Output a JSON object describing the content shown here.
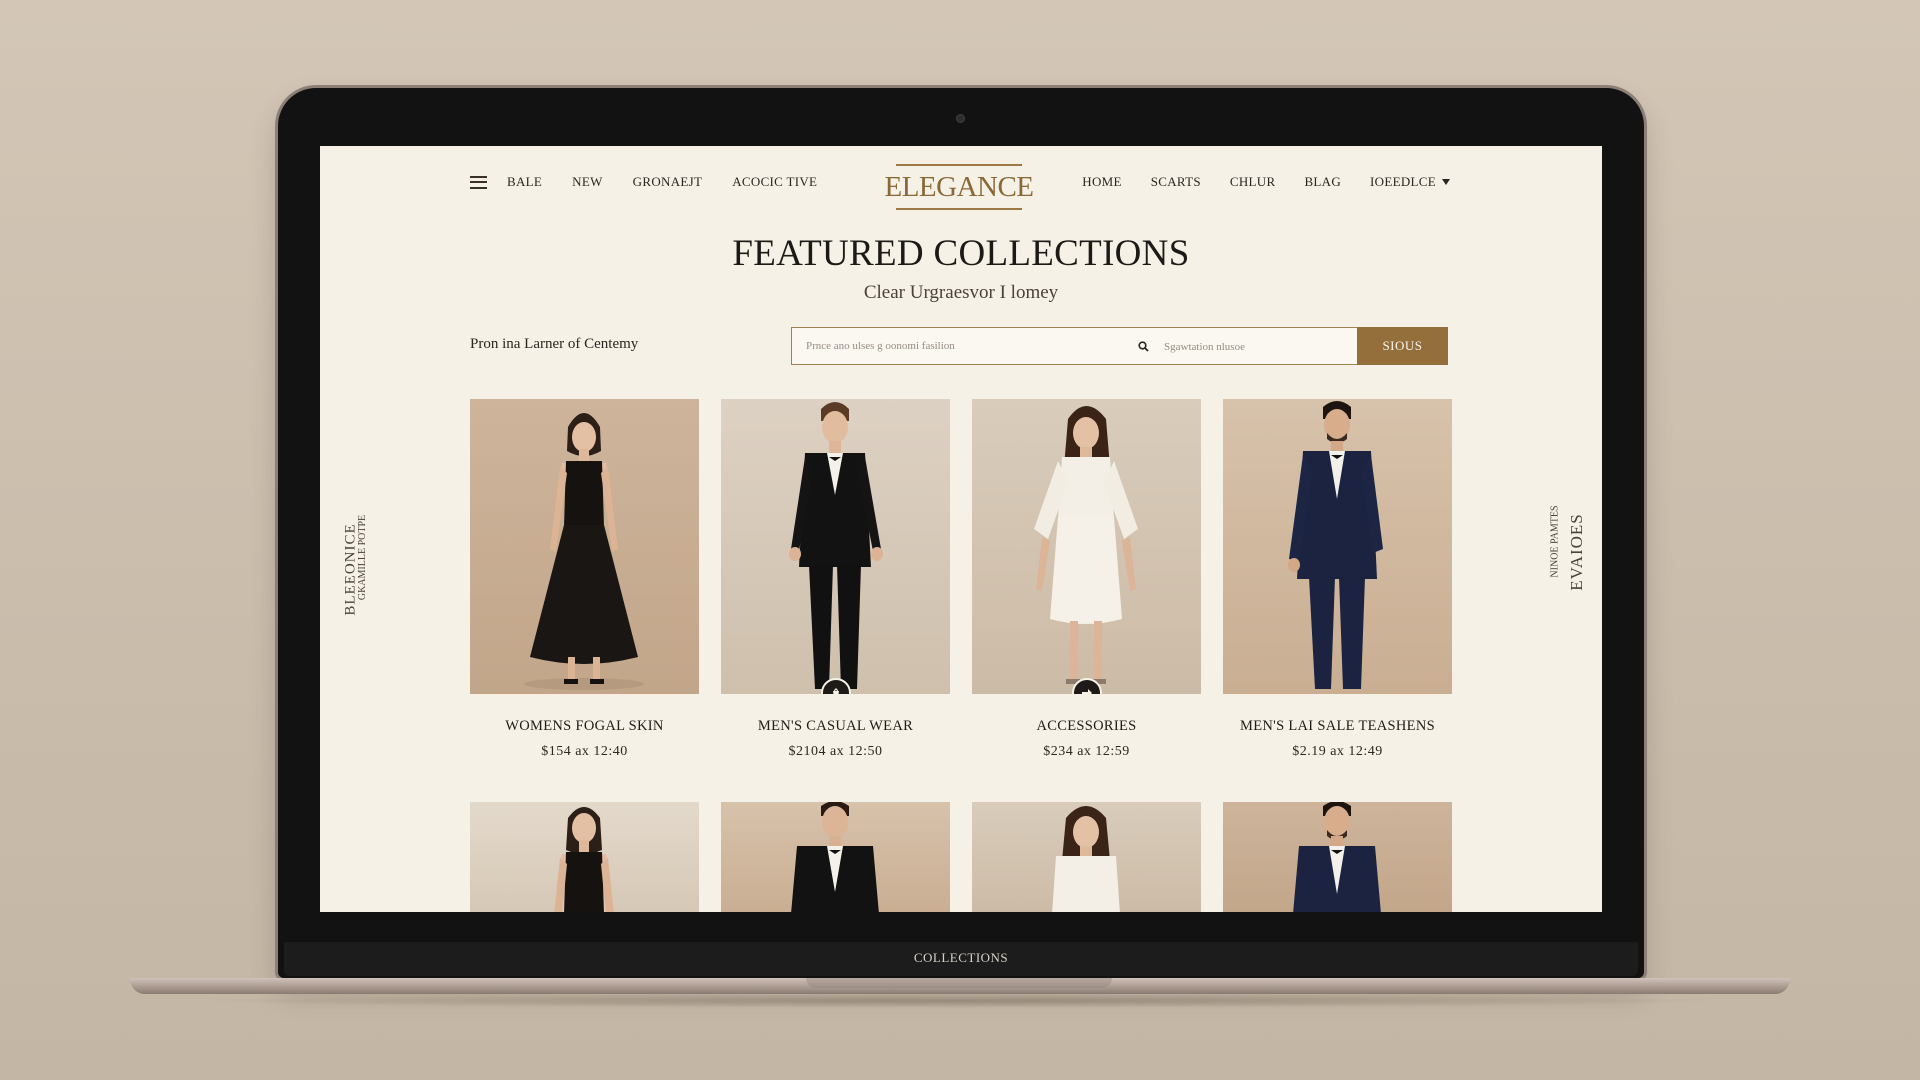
{
  "nav": {
    "left": [
      "BALE",
      "NEW",
      "GRONAEJT",
      "ACOCIC TIVE"
    ],
    "logo": "ELEGANCE",
    "right": [
      "HOME",
      "SCARTS",
      "CHLUR",
      "BLAG",
      "IOEEDLCE"
    ]
  },
  "page": {
    "title": "FEATURED COLLECTIONS",
    "subtitle": "Clear Urgraesvor I lomey",
    "promo": "Pron ina Larner of Centemy"
  },
  "search": {
    "placeholder": "Prnce ano ulses g oonomi fasilion",
    "email_placeholder": "Sgawtation nlusoe",
    "button": "SIOUS"
  },
  "side": {
    "left_main": "BLEEONICE",
    "left_sub": "GKAMILLE POTPE",
    "right_main": "EVAIOES",
    "right_sub": "NINOE PAMTES"
  },
  "products": [
    {
      "name": "WOMENS FOGAL SKIN",
      "price": "$154 ax 12:40"
    },
    {
      "name": "MEN'S CASUAL WEAR",
      "price": "$2104 ax 12:50"
    },
    {
      "name": "ACCESSORIES",
      "price": "$234 ax 12:59"
    },
    {
      "name": "MEN'S LAI SALE TEASHENS",
      "price": "$2.19 ax 12:49"
    }
  ],
  "laptop": {
    "chin_label": "COLLECTIONS"
  },
  "colors": {
    "accent": "#946f3c",
    "background": "#f6f1e6",
    "text": "#1c1a17"
  },
  "icons": [
    "menu-icon",
    "search-icon",
    "cart-icon",
    "arrow-right-icon",
    "chevron-down-icon"
  ]
}
